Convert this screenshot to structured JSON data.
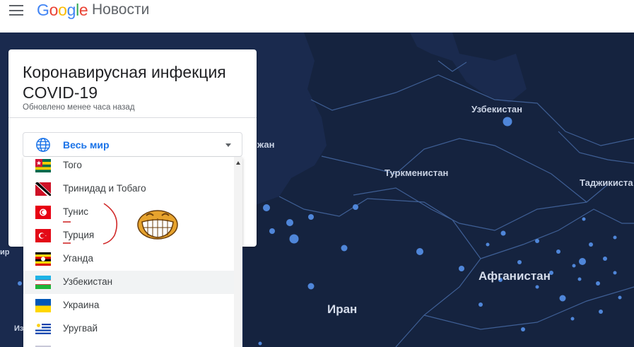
{
  "header": {
    "menu_icon": "menu-icon",
    "logo": [
      "G",
      "o",
      "o",
      "g",
      "l",
      "e"
    ],
    "product": "Новости"
  },
  "card": {
    "title": "Коронавирусная инфекция COVID-19",
    "updated": "Обновлено менее часа назад",
    "region_icon": "globe-icon",
    "region_selected": "Весь мир"
  },
  "dropdown": {
    "items": [
      {
        "name": "Того",
        "flag": "togo"
      },
      {
        "name": "Тринидад и Тобаго",
        "flag": "trinidad"
      },
      {
        "name": "Тунис",
        "flag": "tunisia"
      },
      {
        "name": "Турция",
        "flag": "turkey"
      },
      {
        "name": "Уганда",
        "flag": "uganda"
      },
      {
        "name": "Узбекистан",
        "flag": "uzbekistan",
        "highlighted": true
      },
      {
        "name": "Украина",
        "flag": "ukraine"
      },
      {
        "name": "Уругвай",
        "flag": "uruguay"
      }
    ]
  },
  "map": {
    "labels": [
      "Узбекистан",
      "Туркменистан",
      "Таджикиста",
      "Афганистан",
      "Иран",
      "жан",
      "ир",
      "Из"
    ],
    "colors": {
      "water": "#1a2a4e",
      "land": "#15233f",
      "dot": "#4f86d9"
    }
  }
}
